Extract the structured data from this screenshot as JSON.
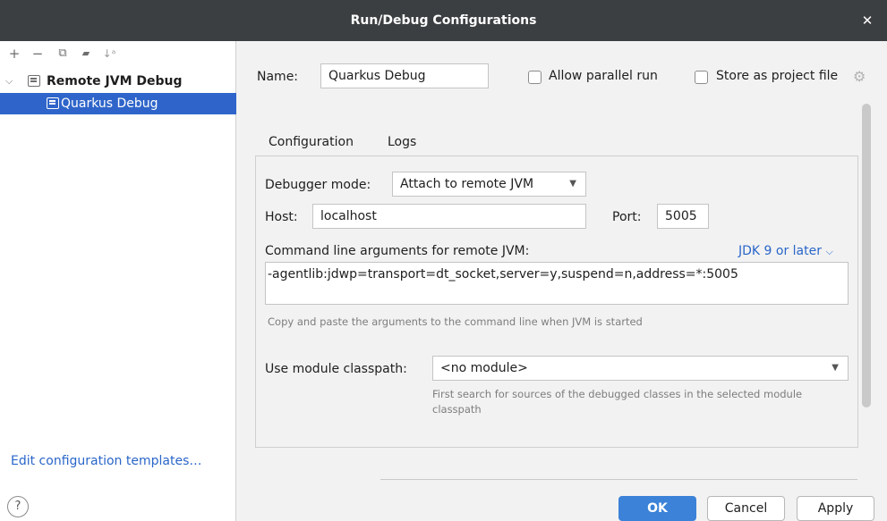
{
  "window": {
    "title": "Run/Debug Configurations",
    "close_glyph": "✕"
  },
  "sidebar": {
    "toolbar": [
      {
        "name": "add",
        "glyph": "+"
      },
      {
        "name": "remove",
        "glyph": "−"
      },
      {
        "name": "copy",
        "glyph": "⧉"
      },
      {
        "name": "move-to-folder",
        "glyph": "▰"
      },
      {
        "name": "sort",
        "glyph": "↓ᵃ"
      }
    ],
    "tree": [
      {
        "label": "Remote JVM Debug",
        "expanded": true,
        "selected": false
      },
      {
        "label": "Quarkus Debug",
        "selected": true
      }
    ],
    "edit_templates_label": "Edit configuration templates…"
  },
  "config": {
    "name_label": "Name:",
    "name_value": "Quarkus Debug",
    "allow_parallel_label": "Allow parallel run",
    "store_project_label": "Store as project file",
    "tabs": [
      {
        "label": "Configuration",
        "active": true
      },
      {
        "label": "Logs",
        "active": false
      }
    ],
    "debugger_mode_label": "Debugger mode:",
    "debugger_mode_value": "Attach to remote JVM",
    "host_label": "Host:",
    "host_value": "localhost",
    "port_label": "Port:",
    "port_value": "5005",
    "cmd_label": "Command line arguments for remote JVM:",
    "jdk_link": "JDK 9 or later",
    "cmd_value": "-agentlib:jdwp=transport=dt_socket,server=y,suspend=n,address=*:5005",
    "cmd_hint": "Copy and paste the arguments to the command line when JVM is started",
    "module_label": "Use module classpath:",
    "module_value": "<no module>",
    "module_hint": "First search for sources of the debugged classes in the selected module classpath"
  },
  "footer": {
    "help_glyph": "?",
    "ok_label": "OK",
    "cancel_label": "Cancel",
    "apply_label": "Apply"
  },
  "colors": {
    "titlebar": "#3c3f41",
    "selection": "#2f65ca",
    "link": "#2a66c9",
    "primary_button": "#3b82d8"
  }
}
